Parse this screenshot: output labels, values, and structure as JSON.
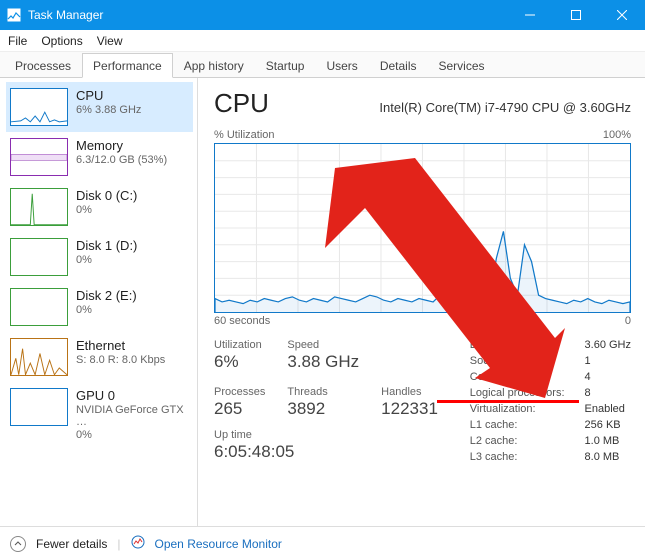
{
  "window": {
    "title": "Task Manager"
  },
  "menu": {
    "file": "File",
    "options": "Options",
    "view": "View"
  },
  "tabs": {
    "processes": "Processes",
    "performance": "Performance",
    "apphistory": "App history",
    "startup": "Startup",
    "users": "Users",
    "details": "Details",
    "services": "Services"
  },
  "sidebar": {
    "items": [
      {
        "name": "CPU",
        "sub": "6% 3.88 GHz"
      },
      {
        "name": "Memory",
        "sub": "6.3/12.0 GB (53%)"
      },
      {
        "name": "Disk 0 (C:)",
        "sub": "0%"
      },
      {
        "name": "Disk 1 (D:)",
        "sub": "0%"
      },
      {
        "name": "Disk 2 (E:)",
        "sub": "0%"
      },
      {
        "name": "Ethernet",
        "sub": "S: 8.0 R: 8.0 Kbps"
      },
      {
        "name": "GPU 0",
        "sub": "NVIDIA GeForce GTX …",
        "sub2": "0%"
      }
    ]
  },
  "detail": {
    "title": "CPU",
    "model": "Intel(R) Core(TM) i7-4790 CPU @ 3.60GHz",
    "chart_top_left": "% Utilization",
    "chart_top_right": "100%",
    "chart_bottom_left": "60 seconds",
    "chart_bottom_right": "0",
    "stats": {
      "utilization_label": "Utilization",
      "utilization": "6%",
      "speed_label": "Speed",
      "speed": "3.88 GHz",
      "processes_label": "Processes",
      "processes": "265",
      "threads_label": "Threads",
      "threads": "3892",
      "handles_label": "Handles",
      "handles": "122331",
      "uptime_label": "Up time",
      "uptime": "6:05:48:05"
    },
    "right": {
      "base_label": "Base",
      "base": "3.60 GHz",
      "sockets_label": "Sockets:",
      "sockets": "1",
      "cores_label": "Cores:",
      "cores": "4",
      "lp_label": "Logical processors:",
      "lp": "8",
      "virt_label": "Virtualization:",
      "virt": "Enabled",
      "l1_label": "L1 cache:",
      "l1": "256 KB",
      "l2_label": "L2 cache:",
      "l2": "1.0 MB",
      "l3_label": "L3 cache:",
      "l3": "8.0 MB"
    }
  },
  "footer": {
    "fewer": "Fewer details",
    "orm": "Open Resource Monitor"
  },
  "chart_data": {
    "type": "line",
    "title": "% Utilization",
    "xlabel": "60 seconds",
    "ylabel": "% Utilization",
    "ylim": [
      0,
      100
    ],
    "x_seconds": [
      60,
      0
    ],
    "series": [
      {
        "name": "CPU",
        "values": [
          8,
          6,
          7,
          6,
          5,
          7,
          6,
          8,
          7,
          6,
          8,
          9,
          7,
          6,
          8,
          7,
          6,
          9,
          8,
          7,
          6,
          8,
          10,
          9,
          7,
          6,
          8,
          7,
          6,
          8,
          7,
          6,
          10,
          12,
          9,
          8,
          7,
          6,
          8,
          7,
          32,
          48,
          20,
          10,
          40,
          30,
          10,
          8,
          7,
          6,
          5,
          7,
          6,
          8,
          6,
          5,
          7,
          6,
          5,
          6
        ]
      }
    ]
  }
}
